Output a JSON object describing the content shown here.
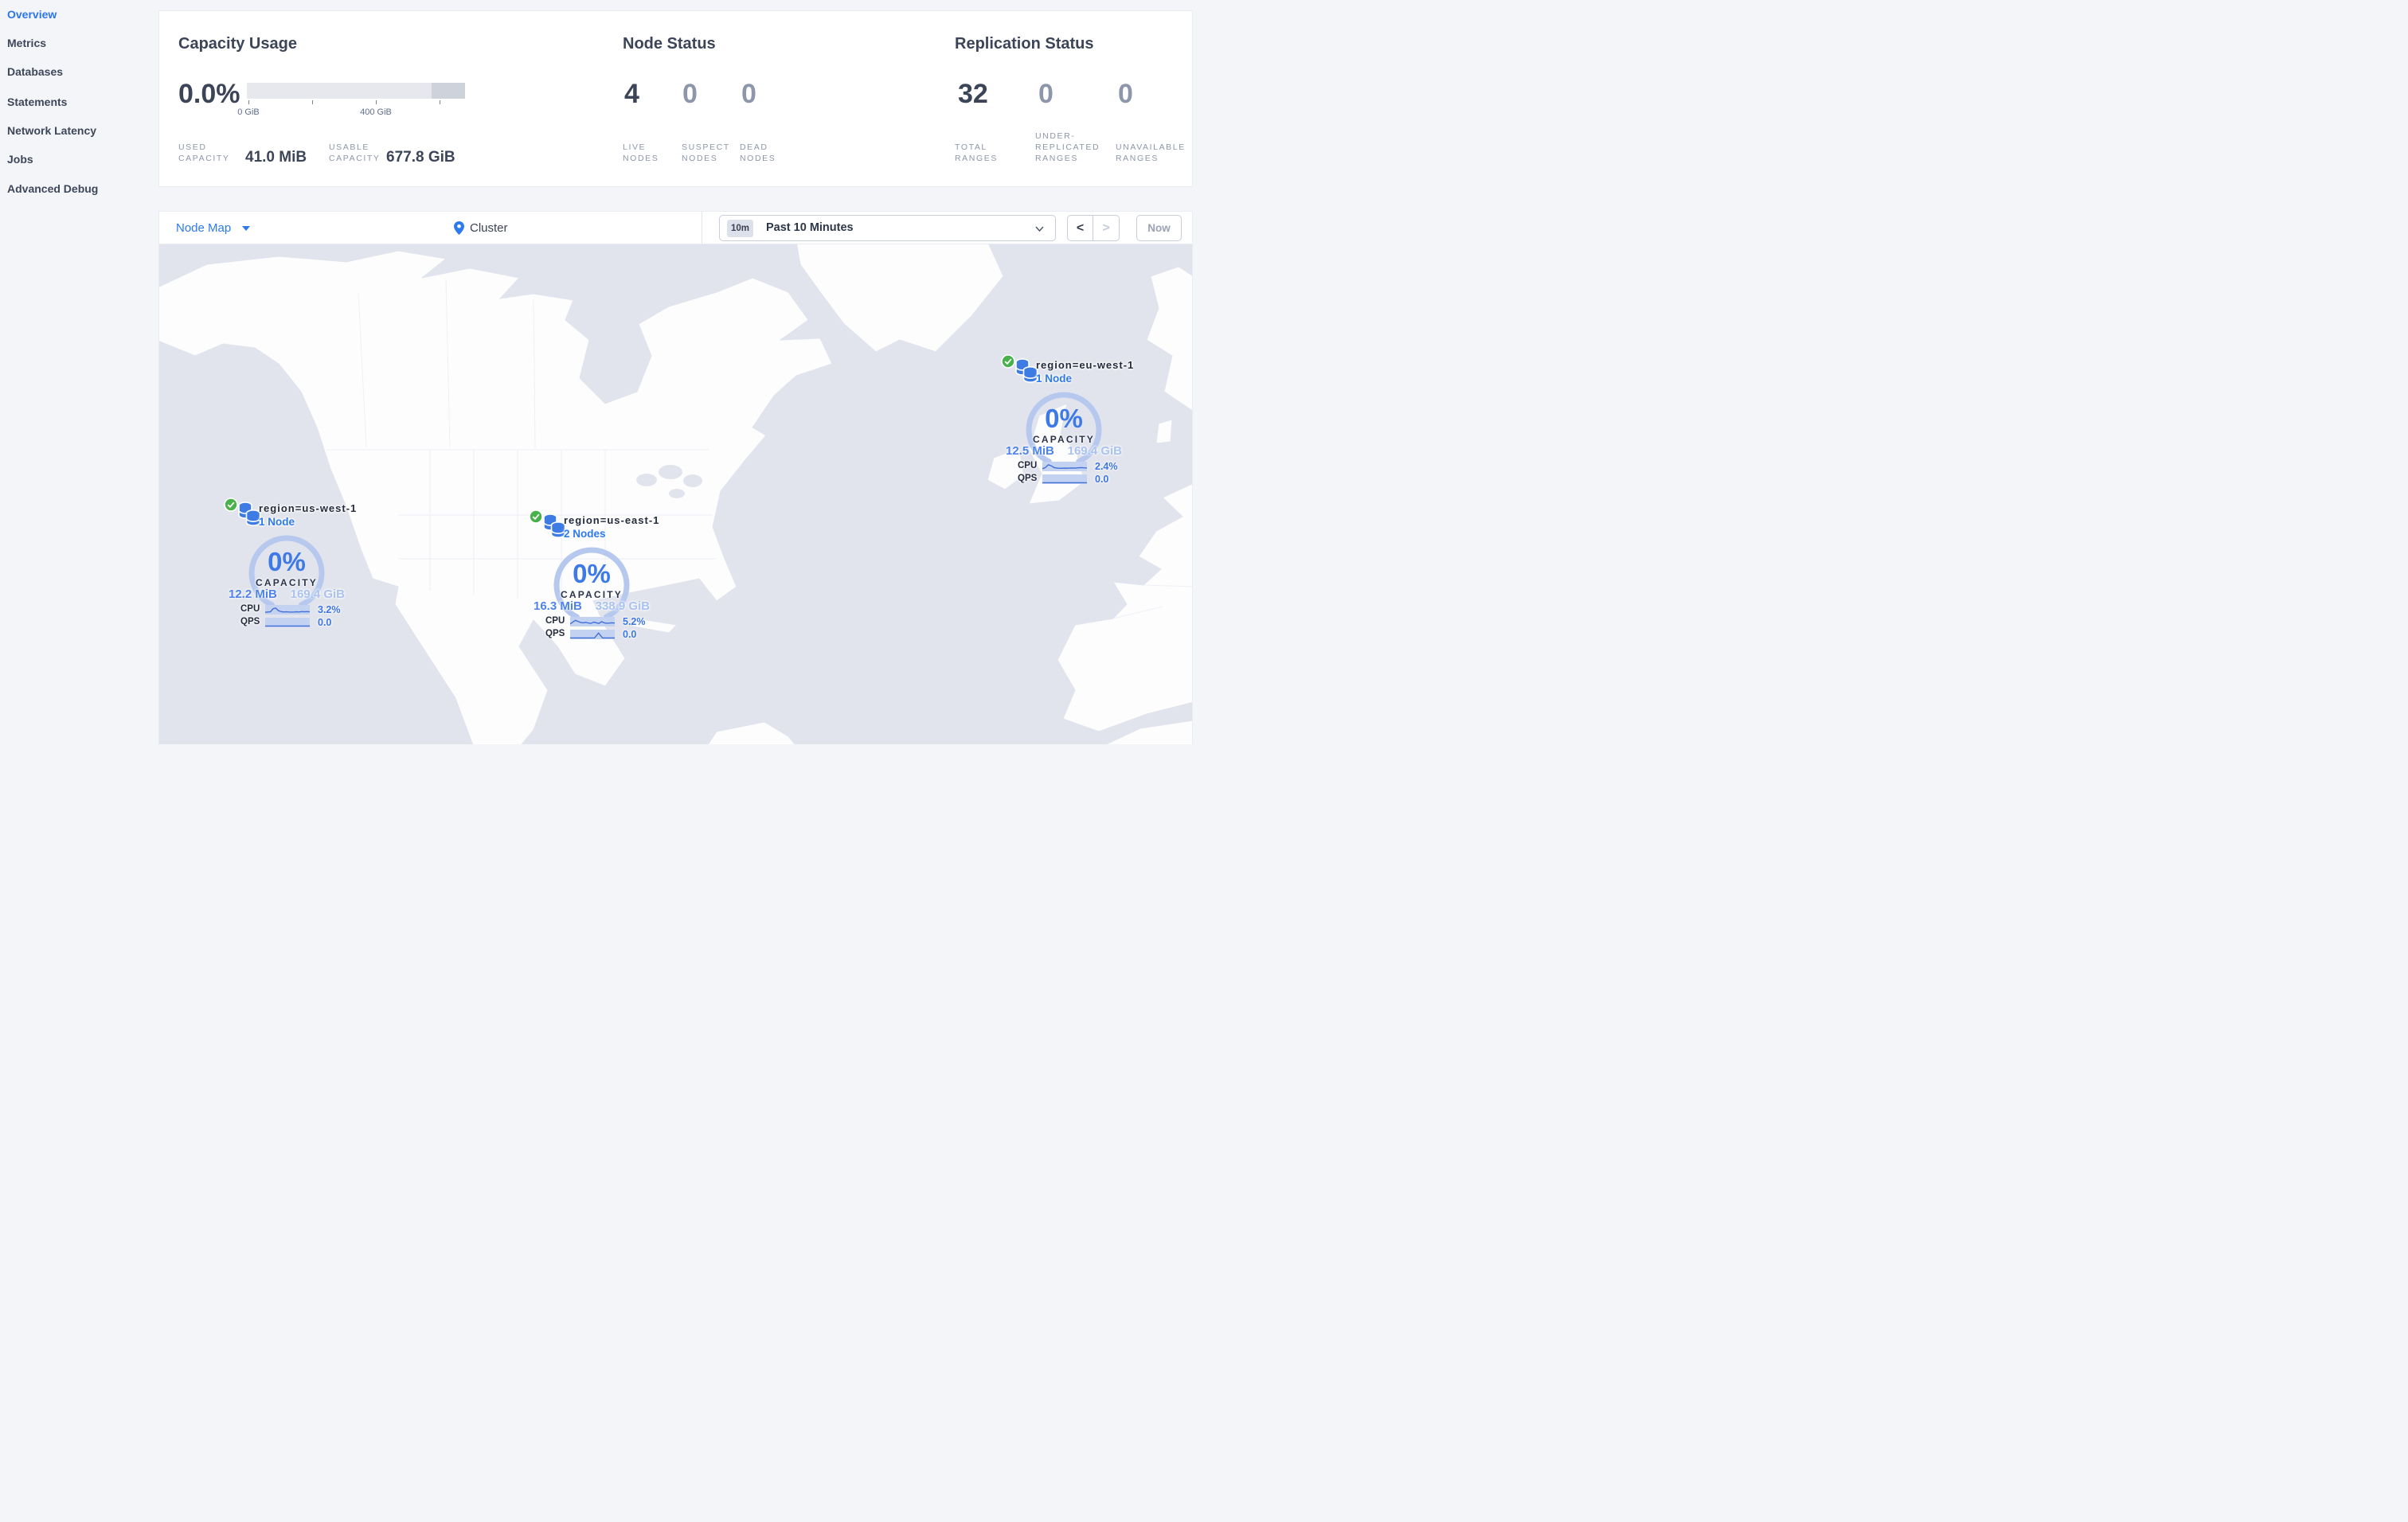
{
  "sidebar": {
    "items": [
      {
        "label": "Overview",
        "active": true
      },
      {
        "label": "Metrics",
        "active": false
      },
      {
        "label": "Databases",
        "active": false
      },
      {
        "label": "Statements",
        "active": false
      },
      {
        "label": "Network Latency",
        "active": false
      },
      {
        "label": "Jobs",
        "active": false
      },
      {
        "label": "Advanced Debug",
        "active": false
      }
    ]
  },
  "summary": {
    "capacity_usage": {
      "title": "Capacity Usage",
      "percent": "0.0%",
      "tick_zero": "0 GiB",
      "tick_400": "400 GiB",
      "used": {
        "label_line1": "USED",
        "label_line2": "CAPACITY",
        "value": "41.0 MiB"
      },
      "usable": {
        "label_line1": "USABLE",
        "label_line2": "CAPACITY",
        "value": "677.8 GiB"
      }
    },
    "node_status": {
      "title": "Node Status",
      "live": {
        "value": "4",
        "label_line1": "LIVE",
        "label_line2": "NODES"
      },
      "suspect": {
        "value": "0",
        "label_line1": "SUSPECT",
        "label_line2": "NODES"
      },
      "dead": {
        "value": "0",
        "label_line1": "DEAD",
        "label_line2": "NODES"
      }
    },
    "replication_status": {
      "title": "Replication Status",
      "total": {
        "value": "32",
        "label_line1": "TOTAL",
        "label_line2": "RANGES"
      },
      "under": {
        "value": "0",
        "label_line1": "UNDER-",
        "label_line2": "REPLICATED",
        "label_line3": "RANGES"
      },
      "unavailable": {
        "value": "0",
        "label_line1": "UNAVAILABLE",
        "label_line2": "RANGES"
      }
    }
  },
  "toolbar": {
    "view_selector": "Node Map",
    "breadcrumb": "Cluster",
    "time_badge": "10m",
    "time_range": "Past 10 Minutes",
    "prev_label": "<",
    "next_label": ">",
    "now_label": "Now"
  },
  "map": {
    "regions": [
      {
        "name": "region=us-west-1",
        "nodes": "1 Node",
        "capacity_percent": "0%",
        "capacity_label": "CAPACITY",
        "used": "12.2 MiB",
        "usable": "169.4 GiB",
        "cpu_label": "CPU",
        "cpu": "3.2%",
        "qps_label": "QPS",
        "qps": "0.0",
        "cpu_spark": [
          0.25,
          0.3,
          0.32,
          0.75,
          0.85,
          0.5,
          0.35,
          0.3,
          0.33,
          0.3,
          0.28,
          0.3,
          0.33,
          0.3,
          0.35,
          0.33,
          0.35,
          0.33
        ],
        "qps_spark": [
          0.12,
          0.12,
          0.12,
          0.12,
          0.12,
          0.12,
          0.12,
          0.12,
          0.12,
          0.12,
          0.12,
          0.12
        ]
      },
      {
        "name": "region=us-east-1",
        "nodes": "2 Nodes",
        "capacity_percent": "0%",
        "capacity_label": "CAPACITY",
        "used": "16.3 MiB",
        "usable": "338.9 GiB",
        "cpu_label": "CPU",
        "cpu": "5.2%",
        "qps_label": "QPS",
        "qps": "0.0",
        "cpu_spark": [
          0.3,
          0.55,
          0.8,
          0.65,
          0.5,
          0.45,
          0.52,
          0.42,
          0.38,
          0.55,
          0.45,
          0.38,
          0.62,
          0.45,
          0.4,
          0.42,
          0.45,
          0.42
        ],
        "qps_spark": [
          0.12,
          0.12,
          0.12,
          0.12,
          0.12,
          0.12,
          0.12,
          0.8,
          0.12,
          0.12,
          0.12,
          0.12
        ]
      },
      {
        "name": "region=eu-west-1",
        "nodes": "1 Node",
        "capacity_percent": "0%",
        "capacity_label": "CAPACITY",
        "used": "12.5 MiB",
        "usable": "169.4 GiB",
        "cpu_label": "CPU",
        "cpu": "2.4%",
        "qps_label": "QPS",
        "qps": "0.0",
        "cpu_spark": [
          0.3,
          0.45,
          0.85,
          0.7,
          0.45,
          0.38,
          0.35,
          0.38,
          0.36,
          0.38,
          0.4,
          0.38,
          0.42,
          0.45,
          0.42,
          0.4
        ],
        "qps_spark": [
          0.12,
          0.12,
          0.12,
          0.12,
          0.12,
          0.12,
          0.12,
          0.12,
          0.12,
          0.12,
          0.12,
          0.12
        ]
      }
    ]
  },
  "colors": {
    "accent_blue": "#2b76ee",
    "dark_text": "#3c4558",
    "muted_text": "#8d96ab",
    "gauge_arc": "#b6c8ee",
    "spark_line": "#3f6fd9",
    "spark_bg": "#c3d2f1",
    "healthy_green": "#49b14c",
    "water": "#e2e4ed",
    "land": "#fdfdfe"
  }
}
